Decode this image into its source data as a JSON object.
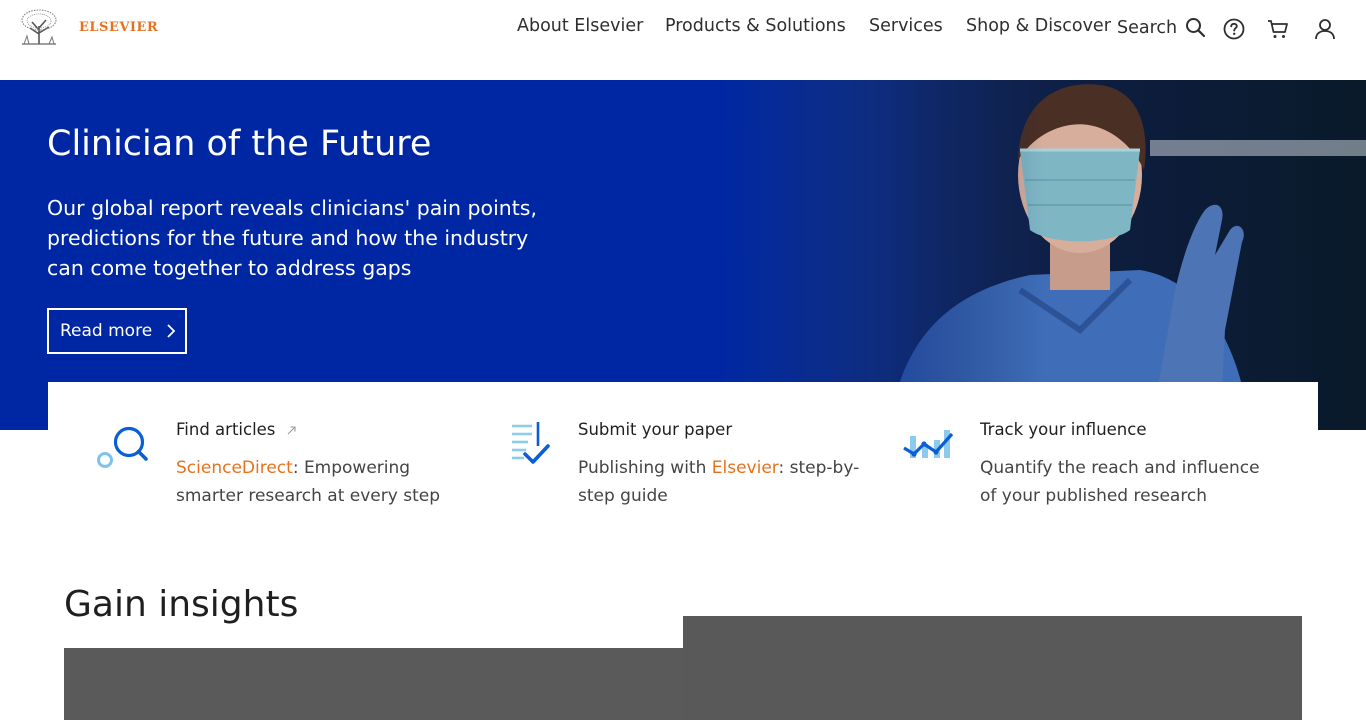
{
  "brand": {
    "name": "ELSEVIER",
    "accent_color": "#e9711c",
    "hero_color": "#0027a3"
  },
  "nav": {
    "items": [
      {
        "label": "About Elsevier"
      },
      {
        "label": "Products & Solutions"
      },
      {
        "label": "Services"
      },
      {
        "label": "Shop & Discover"
      }
    ],
    "search_label": "Search",
    "icons": [
      "search-icon",
      "help-icon",
      "cart-icon",
      "user-icon"
    ]
  },
  "hero": {
    "title": "Clinician of the Future",
    "text": "Our global report reveals clinicians' pain points, predictions for the future and how the industry can come together to address gaps",
    "button_label": "Read more"
  },
  "cards": [
    {
      "title": "Find articles",
      "desc_accent": "ScienceDirect",
      "desc_rest": ": Empowering smarter research at every step",
      "icon": "magnifier-icon"
    },
    {
      "title": "Submit your paper",
      "desc_pre": "Publishing with ",
      "desc_accent": "Elsevier",
      "desc_rest": ": step-by-step guide",
      "icon": "document-check-icon"
    },
    {
      "title": "Track your influence",
      "desc": "Quantify the reach and influence of your published research",
      "icon": "trend-chart-icon"
    }
  ],
  "insights": {
    "title": "Gain insights"
  }
}
